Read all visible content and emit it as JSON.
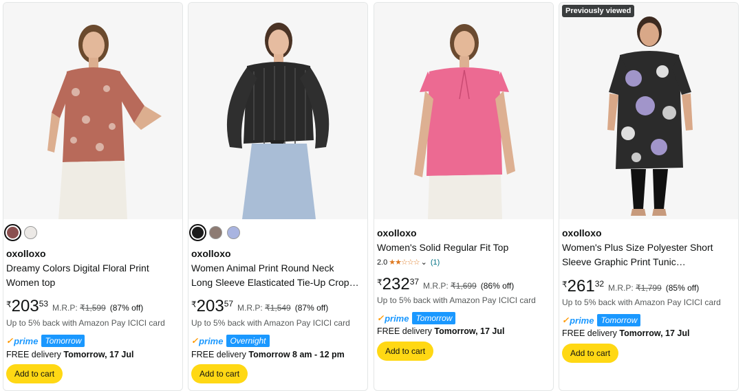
{
  "products": [
    {
      "brand": "oxolloxo",
      "title_line1": "Dreamy Colors Digital Floral Print",
      "title_line2": "Women top",
      "price_symbol": "₹",
      "price_whole": "203",
      "price_fraction": "53",
      "mrp_label": "M.R.P:",
      "mrp_value": "₹1,599",
      "discount": "(87% off)",
      "cashback": "Up to 5% back with Amazon Pay ICICI card",
      "prime_label": "prime",
      "prime_tag": "Tomorrow",
      "delivery_prefix": "FREE delivery",
      "delivery_date": "Tomorrow, 17 Jul",
      "cart_label": "Add to cart",
      "swatches": [
        "#8a4f4f",
        "#ece9e6"
      ]
    },
    {
      "brand": "oxolloxo",
      "title_line1": "Women Animal Print Round Neck",
      "title_line2": "Long Sleeve Elasticated Tie-Up Crop…",
      "price_symbol": "₹",
      "price_whole": "203",
      "price_fraction": "57",
      "mrp_label": "M.R.P:",
      "mrp_value": "₹1,549",
      "discount": "(87% off)",
      "cashback": "Up to 5% back with Amazon Pay ICICI card",
      "prime_label": "prime",
      "prime_tag": "Overnight",
      "delivery_prefix": "FREE delivery",
      "delivery_date": "Tomorrow 8 am - 12 pm",
      "cart_label": "Add to cart",
      "swatches": [
        "#1c1c1c",
        "#8d7b73",
        "#a9b4e0"
      ]
    },
    {
      "brand": "oxolloxo",
      "title_line1": "Women's Solid Regular Fit Top",
      "rating_value": "2.0",
      "rating_stars": 2,
      "rating_count": "(1)",
      "price_symbol": "₹",
      "price_whole": "232",
      "price_fraction": "37",
      "mrp_label": "M.R.P:",
      "mrp_value": "₹1,699",
      "discount": "(86% off)",
      "cashback": "Up to 5% back with Amazon Pay ICICI card",
      "prime_label": "prime",
      "prime_tag": "Tomorrow",
      "delivery_prefix": "FREE delivery",
      "delivery_date": "Tomorrow, 17 Jul",
      "cart_label": "Add to cart"
    },
    {
      "badge": "Previously viewed",
      "brand": "oxolloxo",
      "title_line1": "Women's Plus Size Polyester Short",
      "title_line2": "Sleeve Graphic Print Tunic…",
      "price_symbol": "₹",
      "price_whole": "261",
      "price_fraction": "32",
      "mrp_label": "M.R.P:",
      "mrp_value": "₹1,799",
      "discount": "(85% off)",
      "cashback": "Up to 5% back with Amazon Pay ICICI card",
      "prime_label": "prime",
      "prime_tag": "Tomorrow",
      "delivery_prefix": "FREE delivery",
      "delivery_date": "Tomorrow, 17 Jul",
      "cart_label": "Add to cart"
    }
  ],
  "colors": {
    "prime_blue": "#1a98ff",
    "prime_check": "#ff9900",
    "cart_yellow": "#ffd814",
    "star_orange": "#de7921"
  }
}
